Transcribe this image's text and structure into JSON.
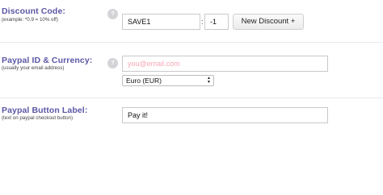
{
  "discount": {
    "label": "Discount Code:",
    "hint": "(example: *0.9 = 10% off)",
    "help": "?",
    "code_value": "SAVE1",
    "colon": ":",
    "amount_value": "-1",
    "new_button": "New Discount +"
  },
  "paypal": {
    "label": "Paypal ID & Currency:",
    "hint": "(usually your email address)",
    "help": "?",
    "email_placeholder": "you@email.com",
    "currency_selected": "Euro (EUR)"
  },
  "button_label": {
    "label": "Paypal Button Label:",
    "hint": "(text on paypal checkout button)",
    "value": "Pay it!"
  },
  "colors": {
    "label": "#5b57a6",
    "placeholder": "#f7a6b8",
    "help_bg": "#d4d4d8"
  }
}
